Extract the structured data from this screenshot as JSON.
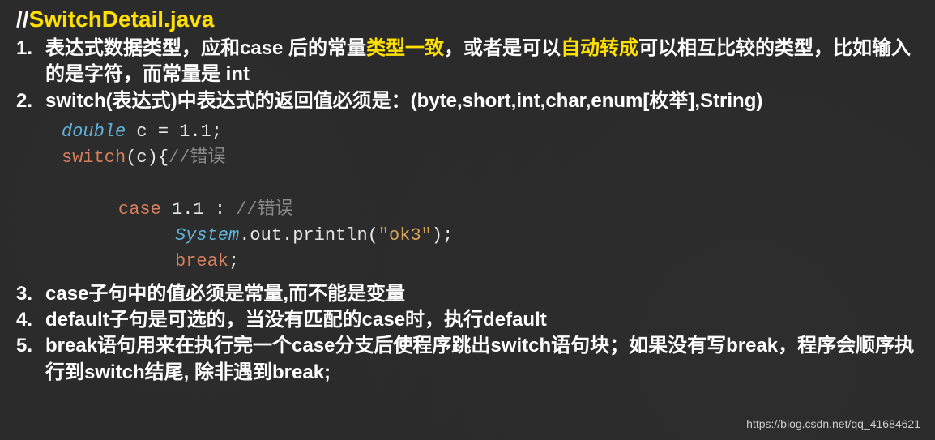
{
  "title": {
    "prefix": "//",
    "filename": "SwitchDetail.java"
  },
  "items": [
    {
      "num": "1.",
      "segments": [
        {
          "t": "表达式数据类型，应和case 后的常量",
          "hl": false
        },
        {
          "t": "类型一致",
          "hl": true
        },
        {
          "t": "，或者是可以",
          "hl": false
        },
        {
          "t": "自动转成",
          "hl": true
        },
        {
          "t": "可以相互比较的类型，比如输入的是字符，而常量是 int",
          "hl": false
        }
      ]
    },
    {
      "num": "2.",
      "segments": [
        {
          "t": "switch(表达式)中表达式的返回值必须是：(byte,short,int,char,enum[枚举],String)",
          "hl": false
        }
      ]
    },
    {
      "num": "3.",
      "segments": [
        {
          "t": "case子句中的值必须是常量,而不能是变量",
          "hl": false
        }
      ]
    },
    {
      "num": "4.",
      "segments": [
        {
          "t": "default子句是可选的，当没有匹配的case时，执行default",
          "hl": false
        }
      ]
    },
    {
      "num": "5.",
      "segments": [
        {
          "t": "break语句用来在执行完一个case分支后使程序跳出switch语句块；如果没有写break，程序会顺序执行到switch结尾, 除非遇到break;",
          "hl": false
        }
      ]
    }
  ],
  "code": {
    "l1": {
      "type": "double",
      "var": "c",
      "op": "=",
      "num": "1.1",
      "semi": ";"
    },
    "l2": {
      "kw": "switch",
      "lp": "(",
      "var": "c",
      "rp": ")",
      "brace": "{",
      "comment": "//错误"
    },
    "l3": {
      "kw": "case",
      "num": "1.1",
      "colon": ":",
      "comment": "//错误"
    },
    "l4": {
      "sys": "System",
      "d1": ".",
      "out": "out",
      "d2": ".",
      "pr": "println",
      "lp": "(",
      "str": "\"ok3\"",
      "rp": ")",
      "semi": ";"
    },
    "l5": {
      "kw": "break",
      "semi": ";"
    }
  },
  "watermark": "https://blog.csdn.net/qq_41684621"
}
